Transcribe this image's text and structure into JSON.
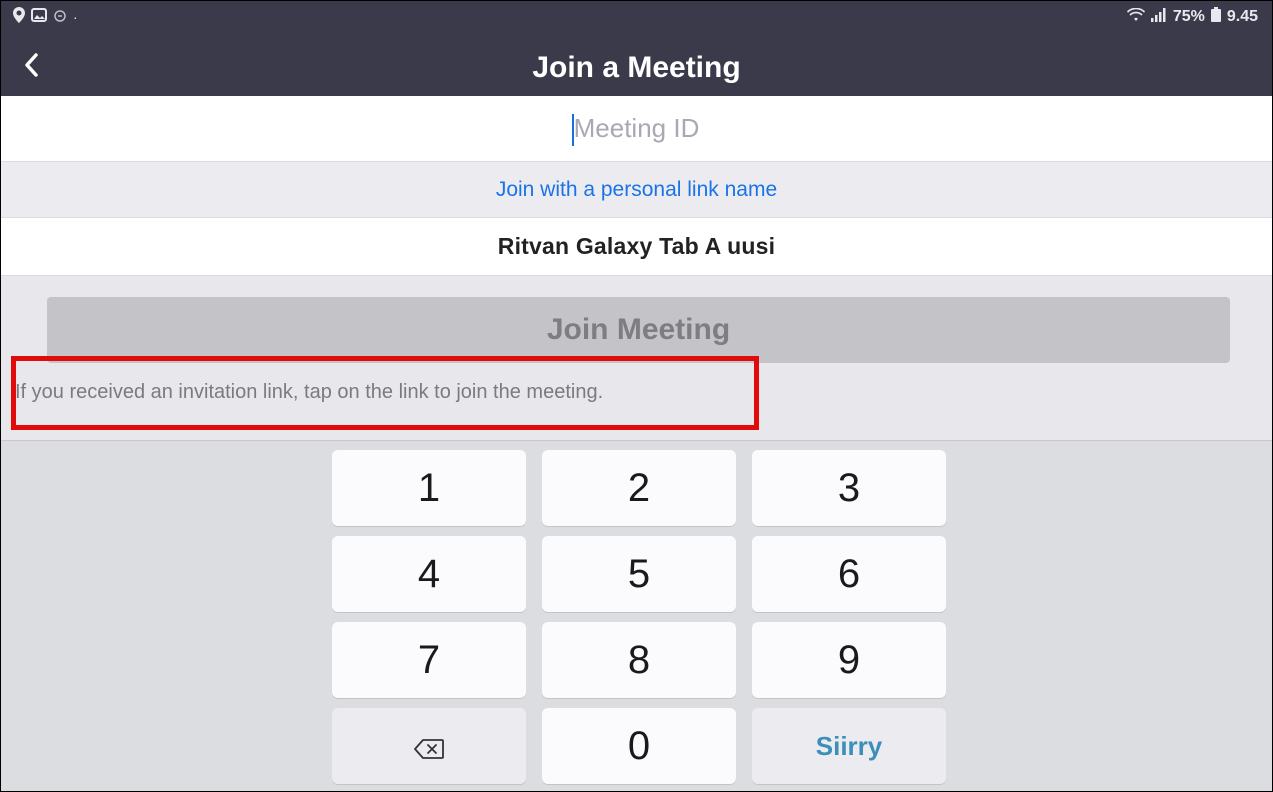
{
  "status_bar": {
    "left_icons": [
      "location-icon",
      "gallery-icon",
      "cloud-icon"
    ],
    "dot": "·",
    "right_icons": [
      "wifi-icon",
      "signal-icon"
    ],
    "battery_percent": "75%",
    "battery_icon": "battery-icon",
    "time": "9.45"
  },
  "header": {
    "title": "Join a Meeting",
    "back_icon": "chevron-left-icon"
  },
  "form": {
    "meeting_id": {
      "value": "",
      "placeholder": "Meeting ID"
    },
    "personal_link_label": "Join with a personal link name",
    "display_name": "Ritvan Galaxy Tab A uusi",
    "join_button_label": "Join Meeting",
    "hint_text": "If you received an invitation link, tap on the link to join the meeting."
  },
  "keypad": {
    "keys": [
      "1",
      "2",
      "3",
      "4",
      "5",
      "6",
      "7",
      "8",
      "9"
    ],
    "zero": "0",
    "backspace_icon": "backspace-icon",
    "go_label": "Siirry"
  },
  "colors": {
    "header_bg": "#3b3a4a",
    "link_blue": "#1a73e8",
    "highlight_red": "#e10b0b",
    "go_blue": "#3c8fb8"
  }
}
